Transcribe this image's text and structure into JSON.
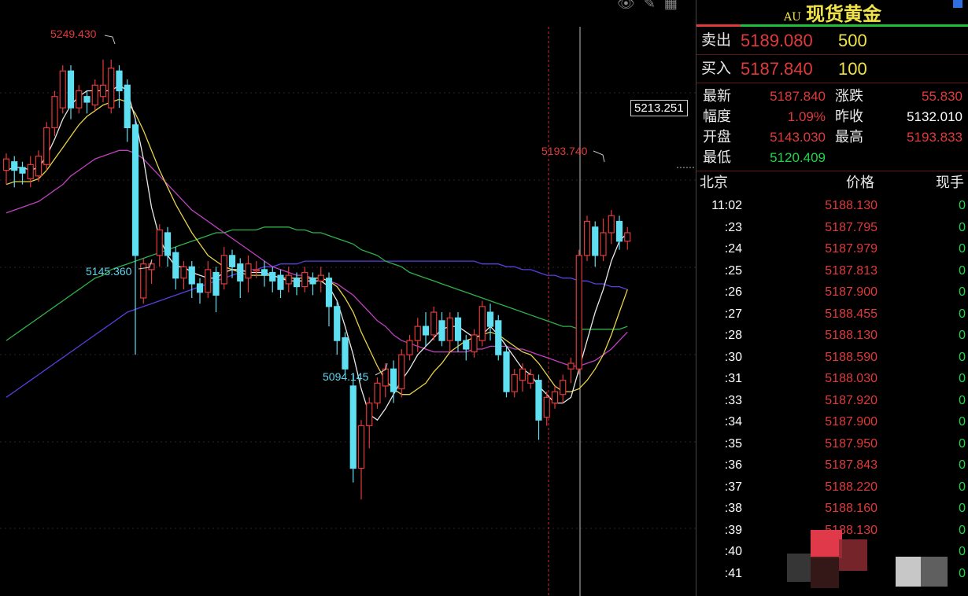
{
  "chart_tools": "👁 ✎ ▦",
  "annotations": {
    "high_label": "5249.430",
    "low1_label": "5145.360",
    "low2_label": "5094.145",
    "recent_high_label": "5193.740",
    "cursor_price": "5213.251"
  },
  "quote": {
    "code": "AU",
    "name": "现货黄金",
    "sell_label": "卖出",
    "sell_price": "5189.080",
    "sell_vol": "500",
    "buy_label": "买入",
    "buy_price": "5187.840",
    "buy_vol": "100",
    "stats": {
      "latest_label": "最新",
      "latest": "5187.840",
      "change_label": "涨跌",
      "change": "55.830",
      "pct_label": "幅度",
      "pct": "1.09%",
      "prev_label": "昨收",
      "prev": "5132.010",
      "open_label": "开盘",
      "open": "5143.030",
      "high_label": "最高",
      "high": "5193.833",
      "low_label": "最低",
      "low": "5120.409"
    },
    "ticks_header": {
      "time": "北京",
      "price": "价格",
      "vol": "现手"
    },
    "ticks": [
      {
        "time": "11:02",
        "price": "5188.130",
        "vol": "0"
      },
      {
        "time": ":23",
        "price": "5187.795",
        "vol": "0"
      },
      {
        "time": ":24",
        "price": "5187.979",
        "vol": "0"
      },
      {
        "time": ":25",
        "price": "5187.813",
        "vol": "0"
      },
      {
        "time": ":26",
        "price": "5187.900",
        "vol": "0"
      },
      {
        "time": ":27",
        "price": "5188.455",
        "vol": "0"
      },
      {
        "time": ":28",
        "price": "5188.130",
        "vol": "0"
      },
      {
        "time": ":30",
        "price": "5188.590",
        "vol": "0"
      },
      {
        "time": ":31",
        "price": "5188.030",
        "vol": "0"
      },
      {
        "time": ":33",
        "price": "5187.920",
        "vol": "0"
      },
      {
        "time": ":34",
        "price": "5187.900",
        "vol": "0"
      },
      {
        "time": ":35",
        "price": "5187.950",
        "vol": "0"
      },
      {
        "time": ":36",
        "price": "5187.843",
        "vol": "0"
      },
      {
        "time": ":37",
        "price": "5188.220",
        "vol": "0"
      },
      {
        "time": ":38",
        "price": "5188.160",
        "vol": "0"
      },
      {
        "time": ":39",
        "price": "5188.130",
        "vol": "0"
      },
      {
        "time": ":40",
        "price": "",
        "vol": "0"
      },
      {
        "time": ":41",
        "price": "",
        "vol": "0"
      }
    ]
  },
  "chart_data": {
    "type": "candlestick",
    "ylim": [
      5060,
      5270
    ],
    "colors": {
      "up": "#e03a3a",
      "down": "#5fe0f2",
      "ma5": "#e8e8e8",
      "ma10": "#e8d24a",
      "ma20": "#c040c0",
      "ma60": "#2fb24a",
      "ma120": "#5a3ee0"
    },
    "candles": [
      [
        5210,
        5214,
        5205,
        5216
      ],
      [
        5213,
        5210,
        5204,
        5215
      ],
      [
        5211,
        5209,
        5205,
        5213
      ],
      [
        5207,
        5212,
        5204,
        5215
      ],
      [
        5208,
        5215,
        5206,
        5217
      ],
      [
        5212,
        5225,
        5210,
        5227
      ],
      [
        5225,
        5236,
        5222,
        5238
      ],
      [
        5232,
        5245,
        5230,
        5247
      ],
      [
        5245,
        5232,
        5228,
        5247
      ],
      [
        5232,
        5238,
        5230,
        5240
      ],
      [
        5236,
        5234,
        5230,
        5238
      ],
      [
        5233,
        5240,
        5231,
        5242
      ],
      [
        5236,
        5240,
        5234,
        5249
      ],
      [
        5232,
        5246,
        5230,
        5249
      ],
      [
        5245,
        5238,
        5232,
        5247
      ],
      [
        5240,
        5225,
        5220,
        5242
      ],
      [
        5226,
        5180,
        5145,
        5228
      ],
      [
        5165,
        5177,
        5163,
        5179
      ],
      [
        5175,
        5177,
        5170,
        5178
      ],
      [
        5180,
        5189,
        5176,
        5191
      ],
      [
        5188,
        5180,
        5176,
        5190
      ],
      [
        5181,
        5172,
        5168,
        5183
      ],
      [
        5172,
        5176,
        5168,
        5178
      ],
      [
        5176,
        5170,
        5165,
        5178
      ],
      [
        5170,
        5167,
        5163,
        5172
      ],
      [
        5167,
        5175,
        5165,
        5178
      ],
      [
        5174,
        5166,
        5160,
        5176
      ],
      [
        5170,
        5180,
        5168,
        5183
      ],
      [
        5180,
        5176,
        5172,
        5182
      ],
      [
        5177,
        5171,
        5165,
        5179
      ],
      [
        5172,
        5177,
        5167,
        5180
      ],
      [
        5175,
        5175,
        5172,
        5178
      ],
      [
        5175,
        5173,
        5169,
        5178
      ],
      [
        5174,
        5171,
        5167,
        5176
      ],
      [
        5173,
        5168,
        5165,
        5175
      ],
      [
        5170,
        5173,
        5167,
        5176
      ],
      [
        5172,
        5169,
        5166,
        5174
      ],
      [
        5169,
        5174,
        5167,
        5176
      ],
      [
        5172,
        5170,
        5166,
        5174
      ],
      [
        5171,
        5173,
        5167,
        5176
      ],
      [
        5172,
        5162,
        5155,
        5174
      ],
      [
        5162,
        5150,
        5145,
        5164
      ],
      [
        5151,
        5140,
        5138,
        5153
      ],
      [
        5134,
        5105,
        5100,
        5138
      ],
      [
        5105,
        5120,
        5094,
        5122
      ],
      [
        5120,
        5128,
        5112,
        5130
      ],
      [
        5128,
        5135,
        5126,
        5137
      ],
      [
        5134,
        5140,
        5130,
        5142
      ],
      [
        5140,
        5132,
        5128,
        5143
      ],
      [
        5133,
        5145,
        5130,
        5147
      ],
      [
        5145,
        5150,
        5143,
        5152
      ],
      [
        5150,
        5155,
        5146,
        5158
      ],
      [
        5155,
        5152,
        5148,
        5160
      ],
      [
        5152,
        5160,
        5150,
        5162
      ],
      [
        5157,
        5150,
        5148,
        5160
      ],
      [
        5150,
        5158,
        5146,
        5160
      ],
      [
        5158,
        5150,
        5146,
        5160
      ],
      [
        5150,
        5147,
        5143,
        5152
      ],
      [
        5146,
        5152,
        5144,
        5154
      ],
      [
        5150,
        5162,
        5148,
        5164
      ],
      [
        5160,
        5155,
        5150,
        5163
      ],
      [
        5157,
        5145,
        5143,
        5159
      ],
      [
        5146,
        5132,
        5130,
        5148
      ],
      [
        5132,
        5138,
        5130,
        5140
      ],
      [
        5136,
        5140,
        5132,
        5142
      ],
      [
        5135,
        5138,
        5133,
        5140
      ],
      [
        5136,
        5122,
        5115,
        5138
      ],
      [
        5123,
        5130,
        5120,
        5132
      ],
      [
        5128,
        5132,
        5126,
        5134
      ],
      [
        5131,
        5136,
        5128,
        5138
      ],
      [
        5140,
        5142,
        5135,
        5144
      ],
      [
        5140,
        5180,
        5138,
        5182
      ],
      [
        5180,
        5192,
        5178,
        5194
      ],
      [
        5190,
        5180,
        5176,
        5192
      ],
      [
        5180,
        5188,
        5178,
        5193
      ],
      [
        5188,
        5194,
        5184,
        5196
      ],
      [
        5192,
        5185,
        5182,
        5194
      ],
      [
        5185,
        5188,
        5182,
        5190
      ]
    ],
    "ma5": [
      5210,
      5211,
      5211,
      5210,
      5211,
      5215,
      5221,
      5228,
      5233,
      5236,
      5238,
      5238,
      5238,
      5238,
      5240,
      5238,
      5228,
      5214,
      5197,
      5186,
      5180,
      5176,
      5176,
      5174,
      5173,
      5172,
      5172,
      5174,
      5175,
      5175,
      5174,
      5174,
      5174,
      5173,
      5172,
      5171,
      5171,
      5171,
      5171,
      5171,
      5169,
      5164,
      5155,
      5145,
      5133,
      5124,
      5122,
      5126,
      5131,
      5136,
      5140,
      5145,
      5148,
      5151,
      5154,
      5155,
      5155,
      5153,
      5151,
      5152,
      5155,
      5152,
      5148,
      5144,
      5140,
      5138,
      5134,
      5131,
      5128,
      5128,
      5130,
      5140,
      5150,
      5160,
      5168,
      5178,
      5185,
      5188
    ],
    "ma10": [
      5205,
      5206,
      5206,
      5206,
      5207,
      5210,
      5214,
      5218,
      5222,
      5226,
      5229,
      5231,
      5233,
      5234,
      5235,
      5234,
      5230,
      5224,
      5217,
      5210,
      5204,
      5198,
      5193,
      5188,
      5184,
      5180,
      5178,
      5176,
      5175,
      5174,
      5173,
      5173,
      5173,
      5173,
      5172,
      5172,
      5172,
      5172,
      5172,
      5172,
      5171,
      5169,
      5165,
      5160,
      5153,
      5147,
      5141,
      5136,
      5133,
      5131,
      5131,
      5133,
      5135,
      5139,
      5142,
      5146,
      5148,
      5150,
      5151,
      5152,
      5153,
      5152,
      5150,
      5148,
      5146,
      5145,
      5142,
      5138,
      5134,
      5132,
      5132,
      5133,
      5136,
      5140,
      5145,
      5152,
      5160,
      5168
    ],
    "ma20": [
      5195,
      5196,
      5197,
      5198,
      5199,
      5201,
      5203,
      5205,
      5208,
      5210,
      5212,
      5214,
      5215,
      5216,
      5217,
      5217,
      5216,
      5214,
      5211,
      5208,
      5205,
      5202,
      5199,
      5196,
      5194,
      5192,
      5190,
      5188,
      5186,
      5184,
      5182,
      5180,
      5178,
      5176,
      5175,
      5174,
      5173,
      5173,
      5172,
      5172,
      5171,
      5170,
      5168,
      5166,
      5163,
      5160,
      5157,
      5155,
      5152,
      5150,
      5149,
      5148,
      5147,
      5146,
      5146,
      5146,
      5146,
      5146,
      5147,
      5147,
      5148,
      5148,
      5148,
      5147,
      5147,
      5146,
      5145,
      5144,
      5143,
      5142,
      5141,
      5141,
      5142,
      5143,
      5145,
      5147,
      5150,
      5153
    ],
    "ma60": [
      5150,
      5152,
      5154,
      5156,
      5158,
      5160,
      5162,
      5164,
      5166,
      5168,
      5170,
      5172,
      5173,
      5175,
      5176,
      5177,
      5178,
      5179,
      5180,
      5181,
      5182,
      5183,
      5184,
      5185,
      5186,
      5187,
      5188,
      5188,
      5189,
      5189,
      5189,
      5189,
      5190,
      5190,
      5190,
      5190,
      5189,
      5189,
      5188,
      5188,
      5187,
      5186,
      5185,
      5184,
      5182,
      5181,
      5180,
      5178,
      5177,
      5176,
      5174,
      5173,
      5172,
      5171,
      5170,
      5169,
      5168,
      5167,
      5166,
      5165,
      5164,
      5163,
      5162,
      5161,
      5160,
      5159,
      5158,
      5157,
      5156,
      5155,
      5155,
      5154,
      5154,
      5154,
      5154,
      5154,
      5154,
      5155
    ],
    "ma120": [
      5130,
      5132,
      5134,
      5136,
      5138,
      5140,
      5142,
      5144,
      5146,
      5148,
      5150,
      5152,
      5154,
      5156,
      5158,
      5160,
      5161,
      5162,
      5163,
      5164,
      5165,
      5166,
      5167,
      5168,
      5169,
      5170,
      5171,
      5172,
      5173,
      5174,
      5175,
      5175,
      5176,
      5176,
      5177,
      5177,
      5177,
      5178,
      5178,
      5178,
      5178,
      5178,
      5178,
      5178,
      5178,
      5178,
      5178,
      5178,
      5178,
      5178,
      5178,
      5178,
      5178,
      5178,
      5178,
      5178,
      5178,
      5178,
      5178,
      5177,
      5177,
      5177,
      5176,
      5176,
      5175,
      5175,
      5174,
      5173,
      5173,
      5172,
      5172,
      5171,
      5171,
      5170,
      5170,
      5169,
      5169,
      5168
    ]
  }
}
